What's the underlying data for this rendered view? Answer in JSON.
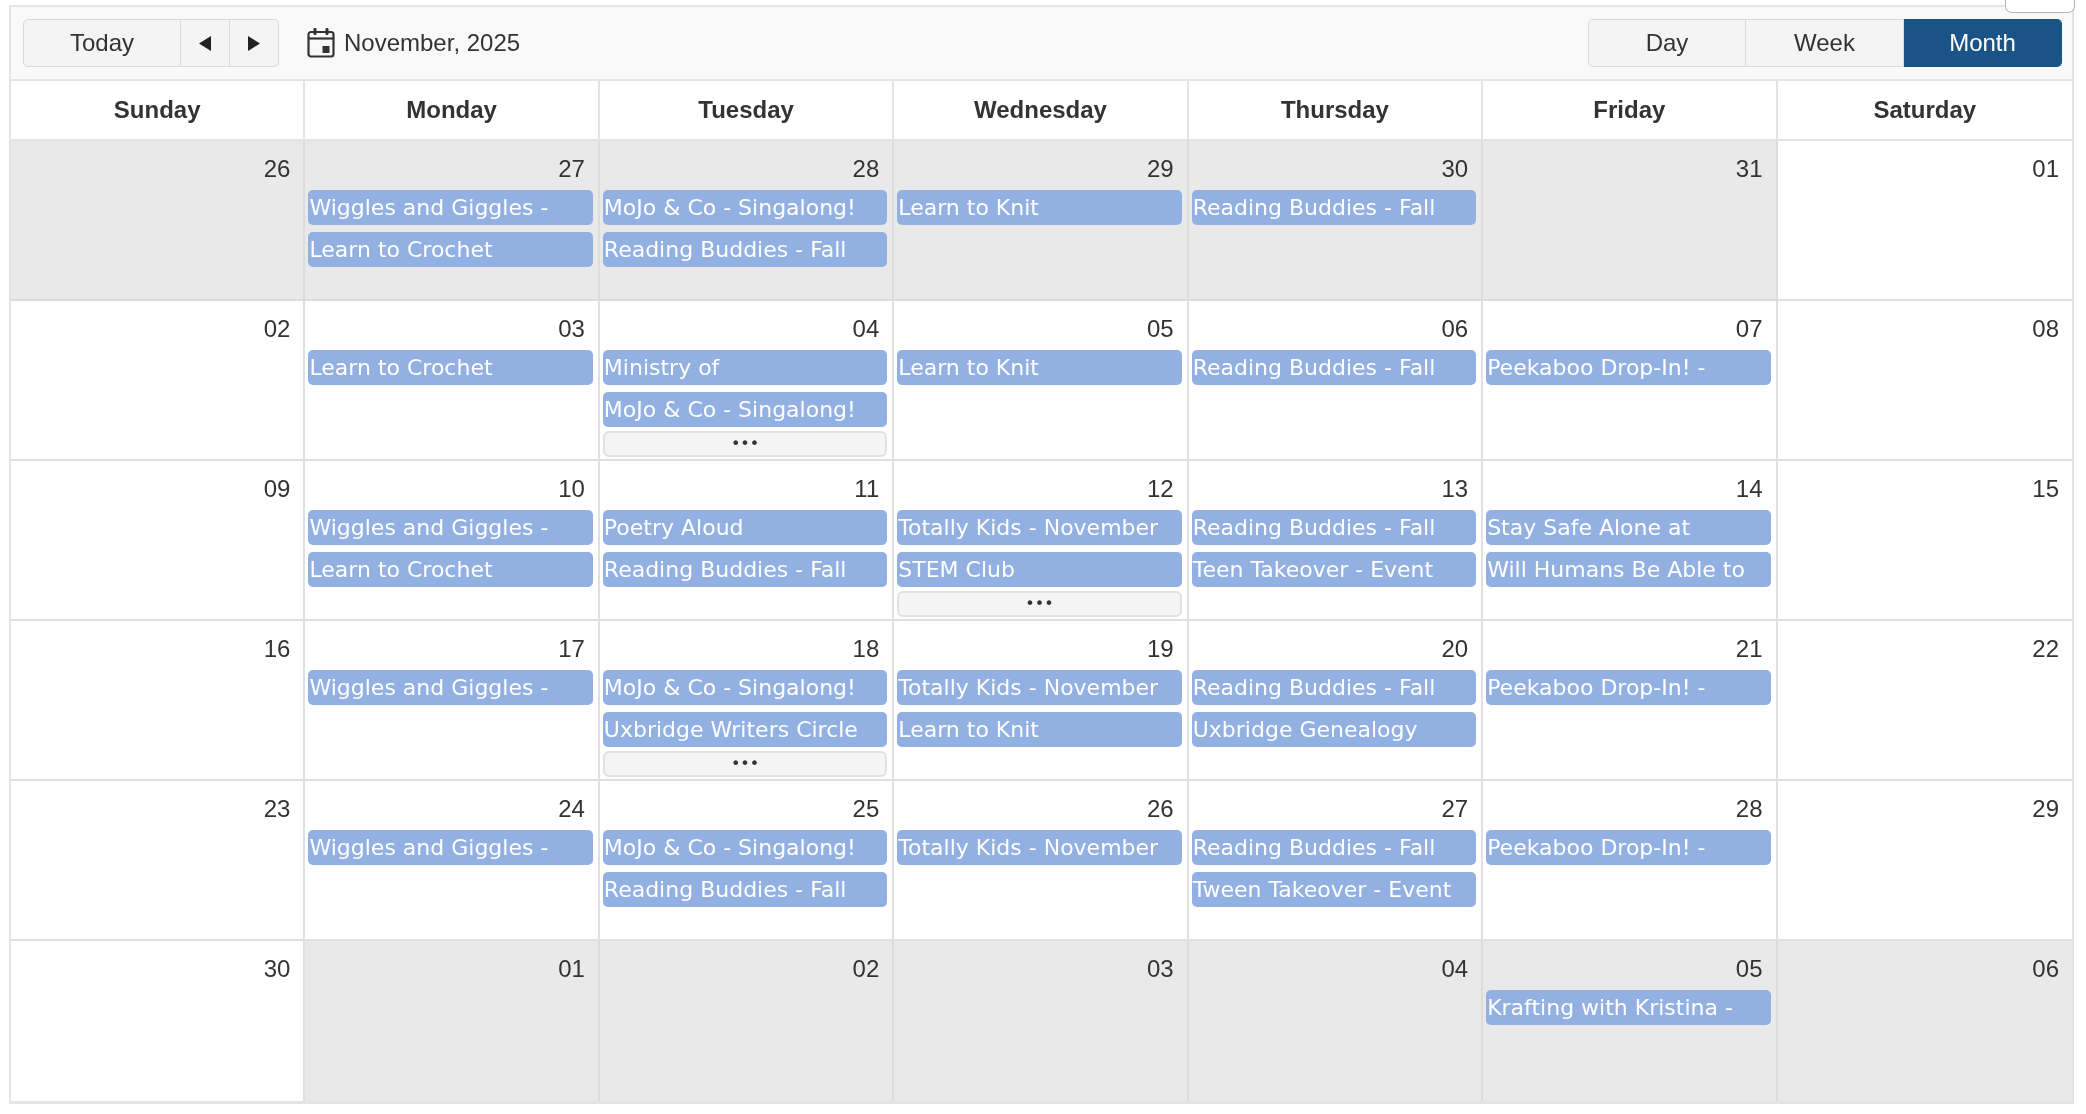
{
  "toolbar": {
    "today_button": "Today",
    "title": "November, 2025",
    "views": [
      {
        "label": "Day",
        "selected": false
      },
      {
        "label": "Week",
        "selected": false
      },
      {
        "label": "Month",
        "selected": true
      }
    ]
  },
  "calendar": {
    "weekdays": [
      "Sunday",
      "Monday",
      "Tuesday",
      "Wednesday",
      "Thursday",
      "Friday",
      "Saturday"
    ],
    "weeks": [
      {
        "days": [
          {
            "date": "26",
            "outside_month": true
          },
          {
            "date": "27",
            "outside_month": true,
            "events": [
              "Wiggles and Giggles -",
              "Learn to Crochet"
            ]
          },
          {
            "date": "28",
            "outside_month": true,
            "events": [
              "MoJo & Co - Singalong!",
              "Reading Buddies - Fall"
            ]
          },
          {
            "date": "29",
            "outside_month": true,
            "events": [
              "Learn to Knit"
            ]
          },
          {
            "date": "30",
            "outside_month": true,
            "events": [
              "Reading Buddies - Fall"
            ]
          },
          {
            "date": "31",
            "outside_month": true
          },
          {
            "date": "01",
            "outside_month": false
          }
        ]
      },
      {
        "days": [
          {
            "date": "02",
            "outside_month": false
          },
          {
            "date": "03",
            "outside_month": false,
            "events": [
              "Learn to Crochet"
            ]
          },
          {
            "date": "04",
            "outside_month": false,
            "events": [
              "Ministry of",
              "MoJo & Co - Singalong!"
            ],
            "more": "•••"
          },
          {
            "date": "05",
            "outside_month": false,
            "events": [
              "Learn to Knit"
            ]
          },
          {
            "date": "06",
            "outside_month": false,
            "events": [
              "Reading Buddies - Fall"
            ]
          },
          {
            "date": "07",
            "outside_month": false,
            "events": [
              "Peekaboo Drop-In! -"
            ]
          },
          {
            "date": "08",
            "outside_month": false
          }
        ]
      },
      {
        "days": [
          {
            "date": "09",
            "outside_month": false
          },
          {
            "date": "10",
            "outside_month": false,
            "events": [
              "Wiggles and Giggles -",
              "Learn to Crochet"
            ]
          },
          {
            "date": "11",
            "outside_month": false,
            "events": [
              "Poetry Aloud",
              "Reading Buddies - Fall"
            ]
          },
          {
            "date": "12",
            "outside_month": false,
            "events": [
              "Totally Kids - November",
              "STEM Club"
            ],
            "more": "•••"
          },
          {
            "date": "13",
            "outside_month": false,
            "events": [
              "Reading Buddies - Fall",
              "Teen Takeover - Event"
            ]
          },
          {
            "date": "14",
            "outside_month": false,
            "events": [
              "Stay Safe Alone at",
              "Will Humans Be Able to"
            ]
          },
          {
            "date": "15",
            "outside_month": false
          }
        ]
      },
      {
        "days": [
          {
            "date": "16",
            "outside_month": false
          },
          {
            "date": "17",
            "outside_month": false,
            "events": [
              "Wiggles and Giggles -"
            ]
          },
          {
            "date": "18",
            "outside_month": false,
            "events": [
              "MoJo & Co - Singalong!",
              "Uxbridge Writers Circle"
            ],
            "more": "•••"
          },
          {
            "date": "19",
            "outside_month": false,
            "events": [
              "Totally Kids - November",
              "Learn to Knit"
            ]
          },
          {
            "date": "20",
            "outside_month": false,
            "events": [
              "Reading Buddies - Fall",
              "Uxbridge Genealogy"
            ]
          },
          {
            "date": "21",
            "outside_month": false,
            "events": [
              "Peekaboo Drop-In! -"
            ]
          },
          {
            "date": "22",
            "outside_month": false
          }
        ]
      },
      {
        "days": [
          {
            "date": "23",
            "outside_month": false
          },
          {
            "date": "24",
            "outside_month": false,
            "events": [
              "Wiggles and Giggles -"
            ]
          },
          {
            "date": "25",
            "outside_month": false,
            "events": [
              "MoJo & Co - Singalong!",
              "Reading Buddies - Fall"
            ]
          },
          {
            "date": "26",
            "outside_month": false,
            "events": [
              "Totally Kids - November"
            ]
          },
          {
            "date": "27",
            "outside_month": false,
            "events": [
              "Reading Buddies - Fall",
              "Tween Takeover - Event"
            ]
          },
          {
            "date": "28",
            "outside_month": false,
            "events": [
              "Peekaboo Drop-In! -"
            ]
          },
          {
            "date": "29",
            "outside_month": false
          }
        ]
      },
      {
        "days": [
          {
            "date": "30",
            "outside_month": false
          },
          {
            "date": "01",
            "outside_month": true
          },
          {
            "date": "02",
            "outside_month": true
          },
          {
            "date": "03",
            "outside_month": true
          },
          {
            "date": "04",
            "outside_month": true
          },
          {
            "date": "05",
            "outside_month": true,
            "events": [
              "Krafting with Kristina -"
            ]
          },
          {
            "date": "06",
            "outside_month": true
          }
        ]
      }
    ]
  }
}
